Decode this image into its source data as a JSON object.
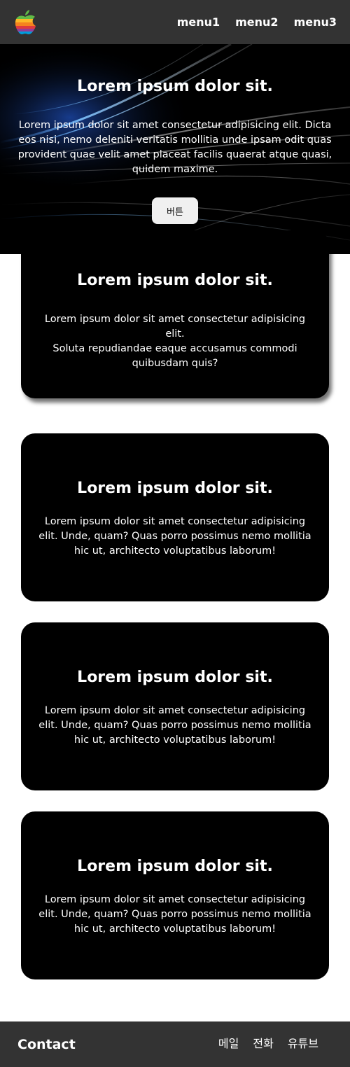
{
  "header": {
    "logo_icon": "apple-logo-icon",
    "menu": [
      "menu1",
      "menu2",
      "menu3"
    ]
  },
  "hero": {
    "title": "Lorem ipsum dolor sit.",
    "text": "Lorem ipsum dolor sit amet consectetur adipisicing elit. Dicta eos nisi, nemo deleniti veritatis mollitia unde ipsam odit quas provident quae velit amet placeat facilis quaerat atque quasi, quidem maxime.",
    "button_label": "버튼"
  },
  "cards": [
    {
      "title": "Lorem ipsum dolor sit.",
      "line1": "Lorem ipsum dolor sit amet consectetur adipisicing elit.",
      "line2": "Soluta repudiandae eaque accusamus commodi quibusdam quis?"
    },
    {
      "title": "Lorem ipsum dolor sit.",
      "text": "Lorem ipsum dolor sit amet consectetur adipisicing elit. Unde, quam? Quas porro possimus nemo mollitia hic ut, architecto voluptatibus laborum!"
    },
    {
      "title": "Lorem ipsum dolor sit.",
      "text": "Lorem ipsum dolor sit amet consectetur adipisicing elit. Unde, quam? Quas porro possimus nemo mollitia hic ut, architecto voluptatibus laborum!"
    },
    {
      "title": "Lorem ipsum dolor sit.",
      "text": "Lorem ipsum dolor sit amet consectetur adipisicing elit. Unde, quam? Quas porro possimus nemo mollitia hic ut, architecto voluptatibus laborum!"
    }
  ],
  "footer": {
    "title": "Contact",
    "links": [
      "메일",
      "전화",
      "유튜브"
    ]
  },
  "colors": {
    "header_bg": "#333333",
    "hero_bg": "#000000",
    "card_bg": "#000000",
    "button_bg": "#f0f0f0",
    "footer_bg": "#333333"
  }
}
